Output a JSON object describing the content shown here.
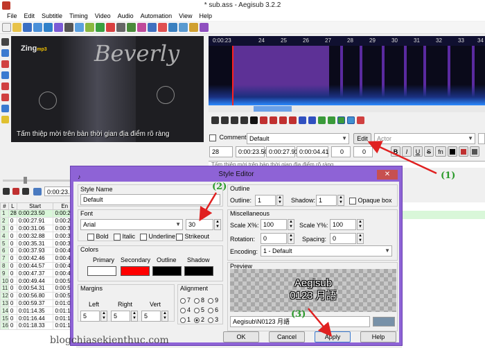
{
  "window": {
    "title": "* sub.ass - Aegisub 3.2.2"
  },
  "menu": [
    "File",
    "Edit",
    "Subtitle",
    "Timing",
    "Video",
    "Audio",
    "Automation",
    "View",
    "Help"
  ],
  "video": {
    "logo": "Zing",
    "logo_suffix": "mp3",
    "overlay_text": "Beverly",
    "subtitle": "Tấm thiệp mời trên bàn thời gian địa điểm rõ ràng"
  },
  "audio": {
    "ruler_labels": [
      "0:00:23",
      "24",
      "25",
      "26",
      "27",
      "28",
      "29",
      "30",
      "31",
      "32",
      "33",
      "34"
    ]
  },
  "editbox": {
    "comment_label": "Comment",
    "style_value": "Default",
    "edit_button": "Edit",
    "actor_placeholder": "Actor",
    "layer": "28",
    "start": "0:00:23.50",
    "end": "0:00:27.91",
    "duration": "0:00:04.41",
    "margin_l": "0",
    "margin_r": "0",
    "bold": "B",
    "italic": "I",
    "underline": "U",
    "strike": "S",
    "fn": "fn",
    "text": "Tấm thiệp mời trên bàn thời gian địa điểm rõ ràng"
  },
  "left_controls": {
    "time": "0:00:23."
  },
  "grid": {
    "headers": [
      "#",
      "L",
      "Start",
      "En"
    ],
    "rows": [
      [
        "1",
        "28",
        "0:00:23.50",
        "0:00:2"
      ],
      [
        "2",
        "0",
        "0:00:27.91",
        "0:00:2"
      ],
      [
        "3",
        "0",
        "0:00:31.06",
        "0:00:3"
      ],
      [
        "4",
        "0",
        "0:00:32.88",
        "0:00:3"
      ],
      [
        "5",
        "0",
        "0:00:35.31",
        "0:00:3"
      ],
      [
        "6",
        "0",
        "0:00:37.93",
        "0:00:4"
      ],
      [
        "7",
        "0",
        "0:00:42.46",
        "0:00:4"
      ],
      [
        "8",
        "0",
        "0:00:44.57",
        "0:00:4"
      ],
      [
        "9",
        "0",
        "0:00:47.37",
        "0:00:4"
      ],
      [
        "10",
        "0",
        "0:00:49.44",
        "0:00:5"
      ],
      [
        "11",
        "0",
        "0:00:54.31",
        "0:00:5"
      ],
      [
        "12",
        "0",
        "0:00:56.80",
        "0:00:5"
      ],
      [
        "13",
        "0",
        "0:00:59.37",
        "0:01:0"
      ],
      [
        "14",
        "0",
        "0:01:14.35",
        "0:01:1"
      ],
      [
        "15",
        "0",
        "0:01:16.44",
        "0:01:1"
      ],
      [
        "16",
        "0",
        "0:01:18.33",
        "0:01:1"
      ]
    ]
  },
  "dialog": {
    "title": "Style Editor",
    "close": "✕",
    "style_name_label": "Style Name",
    "style_name": "Default",
    "font_label": "Font",
    "font": "Arial",
    "font_size": "30",
    "bold": "Bold",
    "italic": "Italic",
    "underline": "Underline",
    "strikeout": "Strikeout",
    "colors_label": "Colors",
    "primary": "Primary",
    "secondary": "Secondary",
    "outline_c": "Outline",
    "shadow_c": "Shadow",
    "color_primary": "#ffffff",
    "color_secondary": "#ff0000",
    "color_outline": "#000000",
    "color_shadow": "#000000",
    "margins_label": "Margins",
    "left": "Left",
    "right": "Right",
    "vert": "Vert",
    "margin_left": "5",
    "margin_right": "5",
    "margin_vert": "5",
    "alignment_label": "Alignment",
    "alignment": [
      "7",
      "8",
      "9",
      "4",
      "5",
      "6",
      "1",
      "2",
      "3"
    ],
    "alignment_selected": "2",
    "outline_group": "Outline",
    "outline_label": "Outline:",
    "outline_value": "1",
    "shadow_label": "Shadow:",
    "shadow_value": "1",
    "opaque_box": "Opaque box",
    "misc_label": "Miscellaneous",
    "scale_x_label": "Scale X%:",
    "scale_x": "100",
    "scale_y_label": "Scale Y%:",
    "scale_y": "100",
    "rotation_label": "Rotation:",
    "rotation": "0",
    "spacing_label": "Spacing:",
    "spacing": "0",
    "encoding_label": "Encoding:",
    "encoding": "1 - Default",
    "preview_label": "Preview",
    "preview_line1": "Aegisub",
    "preview_line2": "0123 月語",
    "preview_text": "Aegisub\\N0123 月語",
    "ok": "OK",
    "cancel": "Cancel",
    "apply": "Apply",
    "help": "Help"
  },
  "annotations": {
    "a1": "(1)",
    "a2": "(2)",
    "a3": "(3)"
  },
  "watermark": "blogchiasekienthuc.com"
}
